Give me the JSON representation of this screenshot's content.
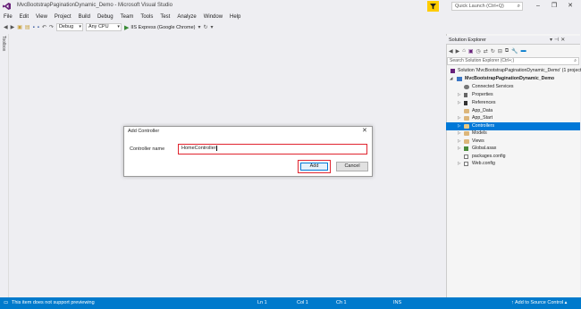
{
  "window": {
    "title": "MvcBootstrapPaginationDynamic_Demo - Microsoft Visual Studio",
    "quick_launch_placeholder": "Quick Launch (Ctrl+Q)",
    "minimize": "–",
    "restore": "❐",
    "close": "✕"
  },
  "menu": [
    "File",
    "Edit",
    "View",
    "Project",
    "Build",
    "Debug",
    "Team",
    "Tools",
    "Test",
    "Analyze",
    "Window",
    "Help"
  ],
  "toolbar": {
    "config": "Debug",
    "platform": "Any CPU",
    "run_target": "IIS Express (Google Chrome)"
  },
  "toolbox_label": "Toolbox",
  "solution_explorer": {
    "title": "Solution Explorer",
    "search_placeholder": "Search Solution Explorer (Ctrl+;)",
    "items": [
      {
        "label": "Solution 'MvcBootstrapPaginationDynamic_Demo' (1 project)"
      },
      {
        "label": "MvcBootstrapPaginationDynamic_Demo"
      },
      {
        "label": "Connected Services"
      },
      {
        "label": "Properties"
      },
      {
        "label": "References"
      },
      {
        "label": "App_Data"
      },
      {
        "label": "App_Start"
      },
      {
        "label": "Controllers"
      },
      {
        "label": "Models"
      },
      {
        "label": "Views"
      },
      {
        "label": "Global.asax"
      },
      {
        "label": "packages.config"
      },
      {
        "label": "Web.config"
      }
    ]
  },
  "dialog": {
    "title": "Add Controller",
    "field_label": "Controller name",
    "field_value": "HomeController",
    "add_label": "Add",
    "cancel_label": "Cancel"
  },
  "statusbar": {
    "message": "This item does not support previewing",
    "line": "Ln 1",
    "col": "Col 1",
    "ch": "Ch 1",
    "mode": "INS",
    "source_control": "Add to Source Control"
  },
  "colors": {
    "accent": "#007acc",
    "selection": "#0078d7",
    "highlight_border": "#e0242f",
    "filter_badge": "#ffcc00"
  }
}
